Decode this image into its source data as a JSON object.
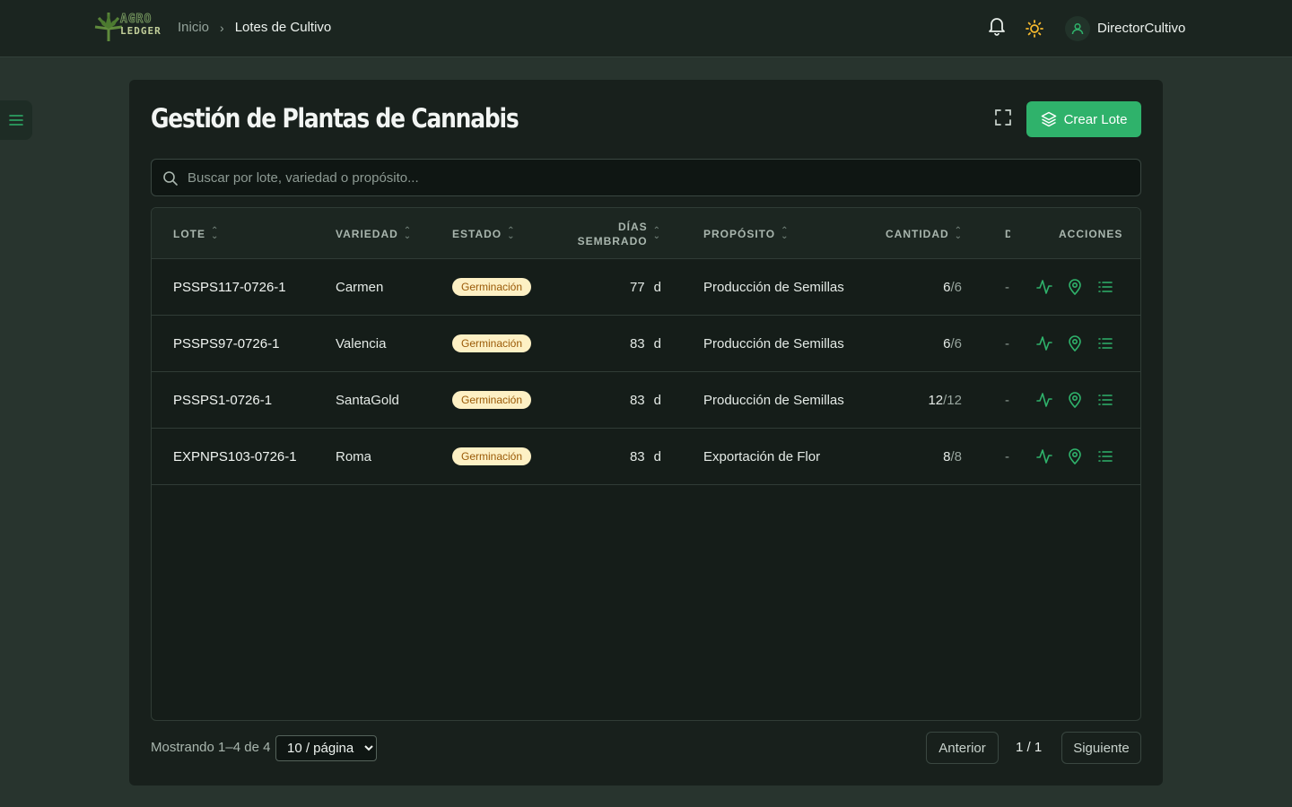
{
  "logo": {
    "line1": "AGRO",
    "line2": "LEDGER"
  },
  "breadcrumb": {
    "home": "Inicio",
    "separator": "›",
    "current": "Lotes de Cultivo"
  },
  "user": {
    "name": "DirectorCultivo"
  },
  "page": {
    "title": "Gestión de Plantas de Cannabis",
    "create_label": "Crear Lote",
    "search_placeholder": "Buscar por lote, variedad o propósito..."
  },
  "table": {
    "headers": {
      "lote": "LOTE",
      "variedad": "VARIEDAD",
      "estado": "ESTADO",
      "dias_line1": "DÍAS",
      "dias_line2": "SEMBRADO",
      "proposito": "PROPÓSITO",
      "cantidad": "CANTIDAD",
      "d": "D",
      "acciones": "ACCIONES"
    },
    "rows": [
      {
        "lote": "PSSPS117-0726-1",
        "variedad": "Carmen",
        "estado": "Germinación",
        "dias": "77",
        "unit": "d",
        "proposito": "Producción de Semillas",
        "cant": "6",
        "cant_total": "/6",
        "d": "-"
      },
      {
        "lote": "PSSPS97-0726-1",
        "variedad": "Valencia",
        "estado": "Germinación",
        "dias": "83",
        "unit": "d",
        "proposito": "Producción de Semillas",
        "cant": "6",
        "cant_total": "/6",
        "d": "-"
      },
      {
        "lote": "PSSPS1-0726-1",
        "variedad": "SantaGold",
        "estado": "Germinación",
        "dias": "83",
        "unit": "d",
        "proposito": "Producción de Semillas",
        "cant": "12",
        "cant_total": "/12",
        "d": "-"
      },
      {
        "lote": "EXPNPS103-0726-1",
        "variedad": "Roma",
        "estado": "Germinación",
        "dias": "83",
        "unit": "d",
        "proposito": "Exportación de Flor",
        "cant": "8",
        "cant_total": "/8",
        "d": "-"
      }
    ]
  },
  "footer": {
    "showing": "Mostrando 1–4 de 4",
    "page_size": "10 / página",
    "prev": "Anterior",
    "page_info": "1 / 1",
    "next": "Siguiente"
  },
  "colors": {
    "accent": "#2fb26b",
    "badge_bg": "#fdf0c4",
    "badge_text": "#9a5a07",
    "sun": "#f5b92e"
  }
}
